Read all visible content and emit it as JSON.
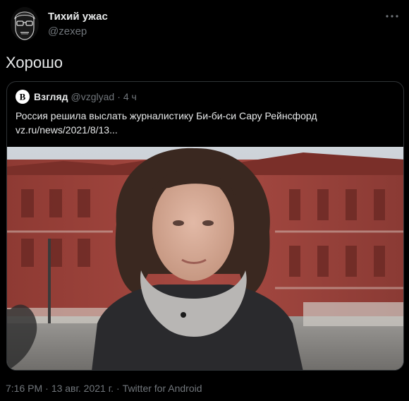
{
  "tweet": {
    "author_name": "Тихий ужас",
    "author_handle": "@zexep",
    "text": "Хорошо",
    "timestamp": "7:16 PM",
    "date": "13 авг. 2021 г.",
    "source": "Twitter for Android",
    "separator": "·"
  },
  "quoted": {
    "name": "Взгляд",
    "handle": "@vzglyad",
    "separator": "·",
    "time": "4 ч",
    "logo_letter": "B",
    "text": "Россия решила выслать журналистику Би-би-си Сару Рейнсфорд",
    "link": "vz.ru/news/2021/8/13..."
  },
  "icons": {
    "more": "more-dots-icon",
    "avatar": "avatar-sketch-icon",
    "logo": "vzglyad-logo-icon"
  },
  "colors": {
    "background": "#000000",
    "text_primary": "#e7e9ea",
    "text_secondary": "#71767b",
    "border": "#2f3336"
  }
}
